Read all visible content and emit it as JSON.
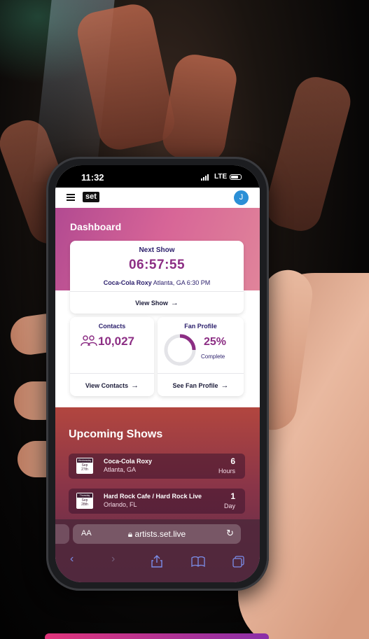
{
  "status_bar": {
    "time": "11:32",
    "network": "LTE"
  },
  "app": {
    "logo": "set",
    "avatar_initial": "J",
    "menu_icon": "hamburger-icon"
  },
  "dashboard": {
    "title": "Dashboard",
    "next_show": {
      "label": "Next Show",
      "countdown": "06:57:55",
      "venue": "Coca-Cola Roxy",
      "location_time": "Atlanta, GA 6:30 PM",
      "link": "View Show"
    },
    "contacts": {
      "label": "Contacts",
      "count": "10,027",
      "link": "View Contacts"
    },
    "fan_profile": {
      "label": "Fan Profile",
      "percent_text": "25%",
      "percent": 25,
      "status": "Complete",
      "link": "See Fan Profile"
    }
  },
  "upcoming": {
    "title": "Upcoming Shows",
    "shows": [
      {
        "weekday": "Wednesday",
        "month": "Sep",
        "day": "27th",
        "name": "Coca-Cola Roxy",
        "city": "Atlanta, GA",
        "count": "6",
        "unit": "Hours"
      },
      {
        "weekday": "Thursday",
        "month": "Sep",
        "day": "28th",
        "name": "Hard Rock Cafe / Hard Rock Live",
        "city": "Orlando, FL",
        "count": "1",
        "unit": "Day"
      }
    ]
  },
  "browser": {
    "text_size": "AA",
    "url": "artists.set.live"
  },
  "colors": {
    "accent": "#8c2e84",
    "navy": "#2a1e6b",
    "avatar": "#2b8fd6"
  }
}
